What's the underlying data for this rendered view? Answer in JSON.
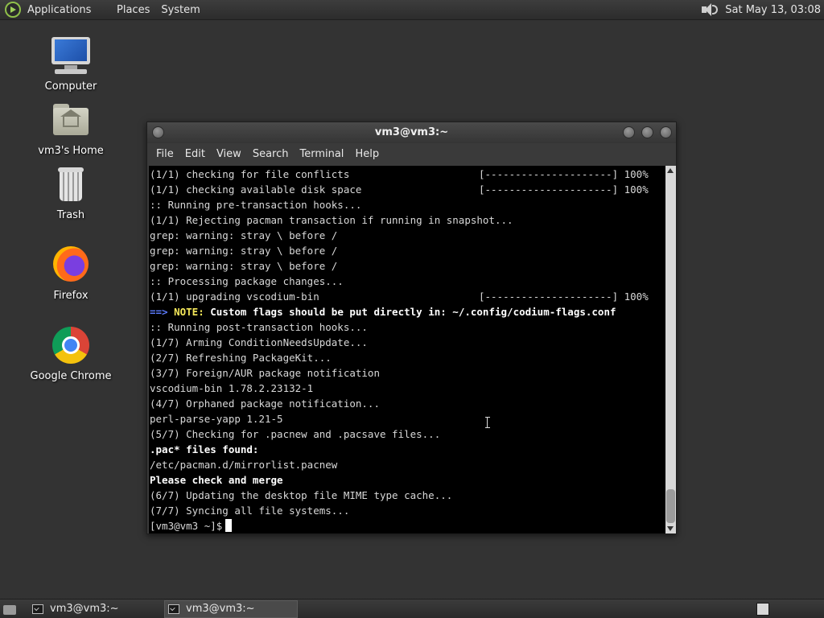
{
  "top_panel": {
    "menus": [
      "Applications",
      "Places",
      "System"
    ],
    "clock": "Sat May 13, 03:08"
  },
  "desktop": {
    "icons": [
      {
        "label": "Computer",
        "icon": "computer-icon"
      },
      {
        "label": "vm3's Home",
        "icon": "home-folder-icon"
      },
      {
        "label": "Trash",
        "icon": "trash-icon"
      },
      {
        "label": "Firefox",
        "icon": "firefox-icon"
      },
      {
        "label": "Google Chrome",
        "icon": "chrome-icon"
      }
    ]
  },
  "terminal": {
    "title": "vm3@vm3:~",
    "menu": [
      "File",
      "Edit",
      "View",
      "Search",
      "Terminal",
      "Help"
    ],
    "lines": [
      {
        "text": "(1/1) checking for file conflicts",
        "progress": "[---------------------] 100%"
      },
      {
        "text": "(1/1) checking available disk space",
        "progress": "[---------------------] 100%"
      },
      {
        "text": ":: Running pre-transaction hooks..."
      },
      {
        "text": "(1/1) Rejecting pacman transaction if running in snapshot..."
      },
      {
        "text": "grep: warning: stray \\ before /"
      },
      {
        "text": "grep: warning: stray \\ before /"
      },
      {
        "text": "grep: warning: stray \\ before /"
      },
      {
        "text": ":: Processing package changes..."
      },
      {
        "text": "(1/1) upgrading vscodium-bin",
        "progress": "[---------------------] 100%"
      },
      {
        "arrow": "==>",
        "note": "NOTE:",
        "text": "Custom flags should be put directly in: ~/.config/codium-flags.conf"
      },
      {
        "text": ":: Running post-transaction hooks..."
      },
      {
        "text": "(1/7) Arming ConditionNeedsUpdate..."
      },
      {
        "text": "(2/7) Refreshing PackageKit..."
      },
      {
        "text": "(3/7) Foreign/AUR package notification"
      },
      {
        "text": "vscodium-bin 1.78.2.23132-1"
      },
      {
        "text": "(4/7) Orphaned package notification..."
      },
      {
        "text": "perl-parse-yapp 1.21-5"
      },
      {
        "text": "(5/7) Checking for .pacnew and .pacsave files..."
      },
      {
        "text": ".pac* files found:",
        "bold": true
      },
      {
        "text": "/etc/pacman.d/mirrorlist.pacnew"
      },
      {
        "text": "Please check and merge",
        "bold": true
      },
      {
        "text": "(6/7) Updating the desktop file MIME type cache..."
      },
      {
        "text": "(7/7) Syncing all file systems..."
      }
    ],
    "prompt": "[vm3@vm3 ~]$"
  },
  "taskbar": {
    "tasks": [
      {
        "label": "vm3@vm3:~"
      },
      {
        "label": "vm3@vm3:~"
      }
    ]
  }
}
